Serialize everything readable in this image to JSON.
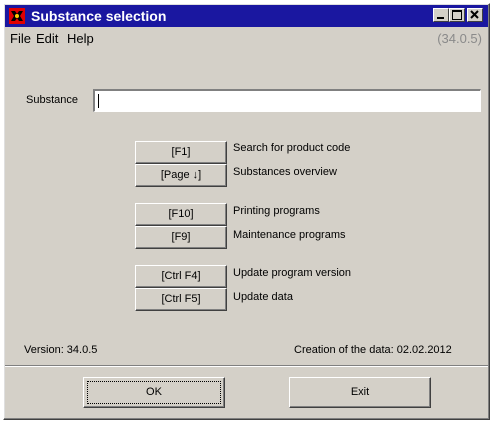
{
  "window": {
    "title": "Substance selection",
    "minimize_glyph": "▁",
    "maximize_glyph": "□",
    "close_glyph": "✕"
  },
  "menu": {
    "file": "File",
    "edit": "Edit",
    "help": "Help",
    "version_hint": "(34.0.5)"
  },
  "search": {
    "label": "Substance",
    "value": ""
  },
  "actions": [
    {
      "key": "[F1]",
      "desc": "Search for product code"
    },
    {
      "key": "[Page ↓]",
      "desc": "Substances overview"
    },
    {
      "key": "[F10]",
      "desc": "Printing programs"
    },
    {
      "key": "[F9]",
      "desc": "Maintenance programs"
    },
    {
      "key": "[Ctrl F4]",
      "desc": "Update program version"
    },
    {
      "key": "[Ctrl F5]",
      "desc": "Update data"
    }
  ],
  "status": {
    "version": "Version:  34.0.5",
    "creation": "Creation of the data:  02.02.2012"
  },
  "footer": {
    "ok": "OK",
    "exit": "Exit"
  },
  "colors": {
    "titlebar": "#1a17a0",
    "face": "#d4d0c8"
  }
}
